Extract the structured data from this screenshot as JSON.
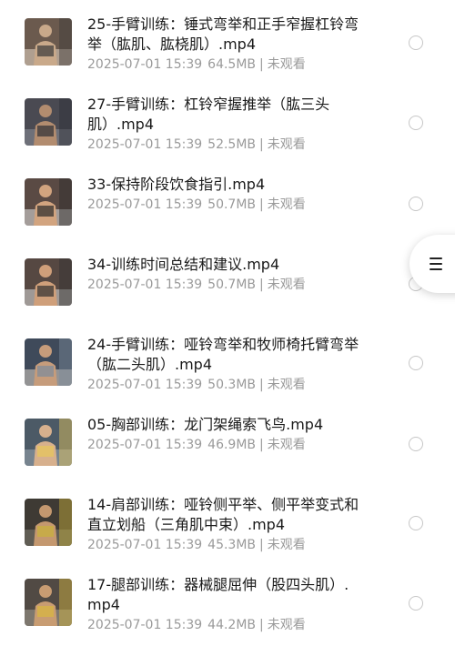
{
  "files": [
    {
      "name": "25-手臂训练：锤式弯举和正手窄握杠铃弯举（肱肌、肱桡肌）.mp4",
      "date": "2025-07-01 15:39",
      "size": "64.5MB",
      "status": "未观看",
      "thumb_icon": "video-thumbnail-icon"
    },
    {
      "name": "27-手臂训练：杠铃窄握推举（肱三头肌）.mp4",
      "date": "2025-07-01 15:39",
      "size": "52.5MB",
      "status": "未观看",
      "thumb_icon": "video-thumbnail-icon"
    },
    {
      "name": "33-保持阶段饮食指引.mp4",
      "date": "2025-07-01 15:39",
      "size": "50.7MB",
      "status": "未观看",
      "thumb_icon": "video-thumbnail-icon"
    },
    {
      "name": "34-训练时间总结和建议.mp4",
      "date": "2025-07-01 15:39",
      "size": "50.7MB",
      "status": "未观看",
      "thumb_icon": "video-thumbnail-icon"
    },
    {
      "name": "24-手臂训练：哑铃弯举和牧师椅托臂弯举（肱二头肌）.mp4",
      "date": "2025-07-01 15:39",
      "size": "50.3MB",
      "status": "未观看",
      "thumb_icon": "video-thumbnail-icon"
    },
    {
      "name": "05-胸部训练：龙门架绳索飞鸟.mp4",
      "date": "2025-07-01 15:39",
      "size": "46.9MB",
      "status": "未观看",
      "thumb_icon": "video-thumbnail-icon"
    },
    {
      "name": "14-肩部训练：哑铃侧平举、侧平举变式和直立划船（三角肌中束）.mp4",
      "date": "2025-07-01 15:39",
      "size": "45.3MB",
      "status": "未观看",
      "thumb_icon": "video-thumbnail-icon"
    },
    {
      "name": "17-腿部训练：器械腿屈伸（股四头肌）.mp4",
      "date": "2025-07-01 15:39",
      "size": "44.2MB",
      "status": "未观看",
      "thumb_icon": "video-thumbnail-icon"
    }
  ],
  "meta_separator": "|",
  "floating_menu": {
    "icon": "menu-icon"
  },
  "colors": {
    "title": "#1a1a1a",
    "meta": "#9a9a9a",
    "radio_border": "#c6c6c6",
    "background": "#ffffff"
  }
}
